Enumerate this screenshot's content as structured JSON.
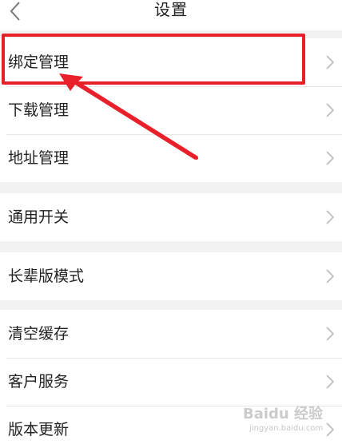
{
  "header": {
    "title": "设置",
    "back_icon": "chevron-left-icon"
  },
  "groups": [
    {
      "items": [
        {
          "label": "绑定管理",
          "highlighted": true
        },
        {
          "label": "下载管理"
        },
        {
          "label": "地址管理"
        }
      ]
    },
    {
      "items": [
        {
          "label": "通用开关"
        }
      ]
    },
    {
      "items": [
        {
          "label": "长辈版模式"
        }
      ]
    },
    {
      "items": [
        {
          "label": "清空缓存"
        },
        {
          "label": "客户服务"
        },
        {
          "label": "版本更新"
        }
      ]
    }
  ],
  "annotation": {
    "highlight_color": "#e8202a",
    "arrow_color": "#e8202a"
  },
  "watermark": {
    "text": "Baidu 经验",
    "url": "jingyan.baidu.com"
  },
  "colors": {
    "background": "#f2f2f2",
    "row_background": "#ffffff",
    "text": "#222222",
    "chevron": "#bbbbbb"
  }
}
